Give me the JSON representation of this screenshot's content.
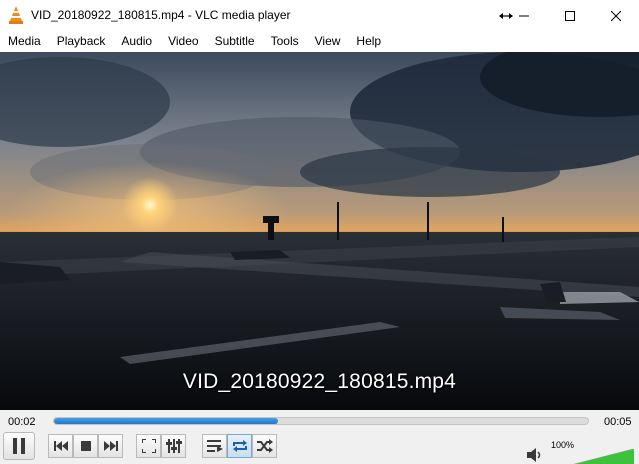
{
  "window": {
    "title": "VID_20180922_180815.mp4 - VLC media player"
  },
  "menu": [
    {
      "label": "Media"
    },
    {
      "label": "Playback"
    },
    {
      "label": "Audio"
    },
    {
      "label": "Video"
    },
    {
      "label": "Subtitle"
    },
    {
      "label": "Tools"
    },
    {
      "label": "View"
    },
    {
      "label": "Help"
    }
  ],
  "video": {
    "overlay_text": "VID_20180922_180815.mp4"
  },
  "playback": {
    "elapsed": "00:02",
    "total": "00:05",
    "progress_fraction": 0.42
  },
  "volume": {
    "label": "100%",
    "level_fraction": 1.0
  },
  "colors": {
    "accent": "#1f74c8",
    "vlc_orange": "#f08a16",
    "volume_green": "#3cc23c"
  },
  "icons": {
    "app": "vlc-cone-icon",
    "resize": "resize-arrows-icon",
    "minimize": "minimize-icon",
    "maximize": "maximize-icon",
    "close": "close-icon",
    "pause": "pause-icon",
    "previous": "previous-icon",
    "stop": "stop-icon",
    "next": "next-icon",
    "fullscreen": "fullscreen-icon",
    "extended_settings": "extended-settings-icon",
    "playlist": "playlist-icon",
    "loop": "loop-icon",
    "shuffle": "shuffle-icon",
    "speaker": "speaker-icon"
  }
}
